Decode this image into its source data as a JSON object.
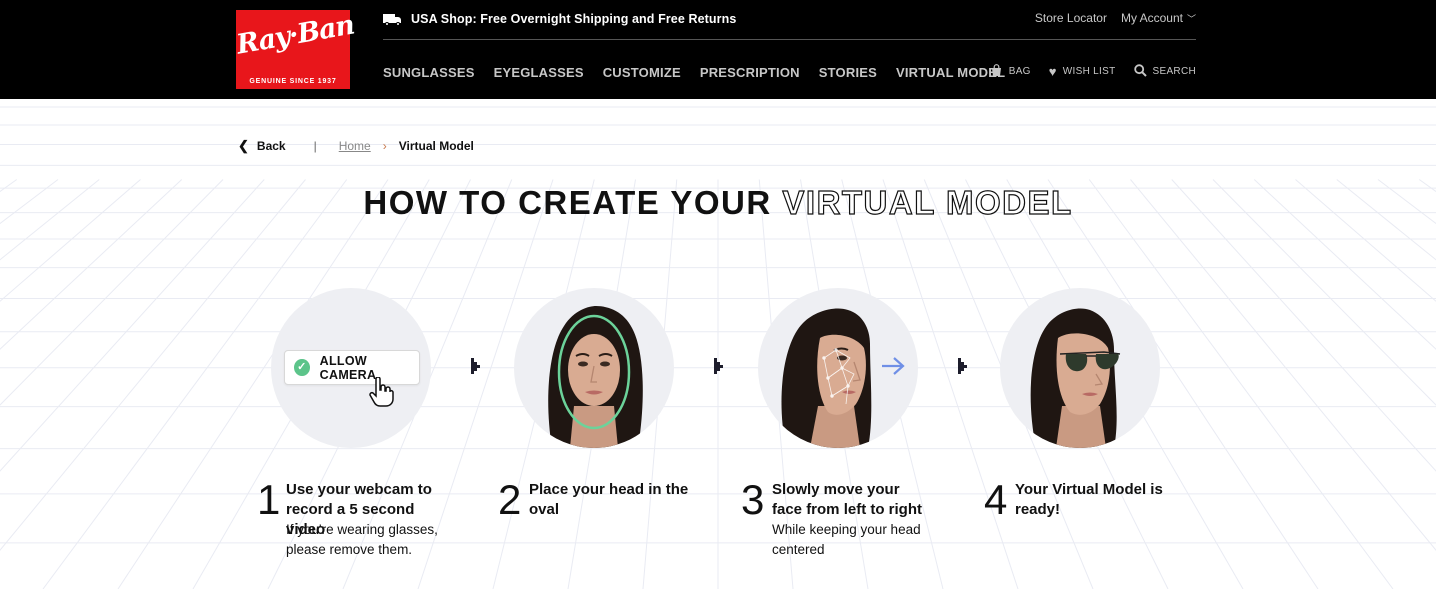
{
  "header": {
    "logo_text": "Ray·Ban",
    "logo_tagline": "GENUINE SINCE 1937",
    "promo": "USA Shop: Free Overnight Shipping and Free Returns",
    "store_locator": "Store Locator",
    "my_account": "My Account",
    "nav": [
      "SUNGLASSES",
      "EYEGLASSES",
      "CUSTOMIZE",
      "PRESCRIPTION",
      "STORIES",
      "VIRTUAL MODEL"
    ],
    "bag": "BAG",
    "wishlist": "WISH LIST",
    "search": "SEARCH"
  },
  "breadcrumb": {
    "back": "Back",
    "home": "Home",
    "current": "Virtual Model"
  },
  "title": {
    "solid": "HOW TO CREATE YOUR",
    "outline": "VIRTUAL MODEL"
  },
  "allow_camera": "ALLOW CAMERA",
  "steps": [
    {
      "num": "1",
      "title": "Use your webcam to record a 5 second video",
      "sub": "If you're wearing glasses, please remove them."
    },
    {
      "num": "2",
      "title": "Place your head in the oval",
      "sub": ""
    },
    {
      "num": "3",
      "title": "Slowly move your face from left to right",
      "sub": "While keeping your head centered"
    },
    {
      "num": "4",
      "title": "Your Virtual Model is ready!",
      "sub": ""
    }
  ],
  "colors": {
    "brand_red": "#e8161b",
    "header_bg": "#000000",
    "check_green": "#5cc48a",
    "oval_green": "#6cd39a",
    "arrow_blue": "#6f8fe6",
    "breadcrumb_arrow": "#c87b4f"
  }
}
